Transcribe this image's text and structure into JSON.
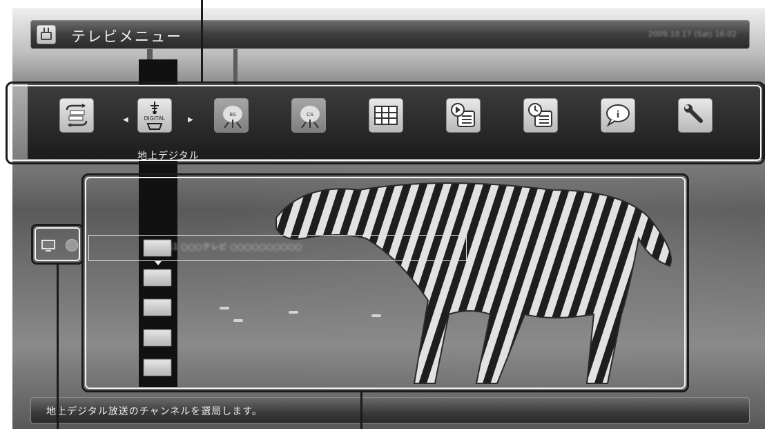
{
  "header": {
    "title": "テレビメニュー",
    "datetime": "2009.10.17 (Sat) 16:02",
    "icon": "tv-icon"
  },
  "menu": {
    "selected_label": "地上デジタル",
    "items": [
      {
        "name": "broadcast-switch",
        "icon": "broadcast-switch-icon"
      },
      {
        "name": "digital-terrestrial",
        "icon": "digital-terrestrial-icon",
        "tile_text": "DIGITAL"
      },
      {
        "name": "bs",
        "icon": "bs-satellite-icon",
        "tile_text": "BS"
      },
      {
        "name": "cs",
        "icon": "cs-satellite-icon",
        "tile_text": "CS"
      },
      {
        "name": "program-guide",
        "icon": "grid-guide-icon"
      },
      {
        "name": "recorded-playback",
        "icon": "play-list-icon"
      },
      {
        "name": "reservation-list",
        "icon": "clock-list-icon"
      },
      {
        "name": "information",
        "icon": "info-bubble-icon",
        "tile_text": "i"
      },
      {
        "name": "settings",
        "icon": "wrench-icon"
      }
    ]
  },
  "channel_list": {
    "selected_row_text": "011 ○○○テレビ ○○○○○○○○○○"
  },
  "footer": {
    "message": "地上デジタル放送のチャンネルを選局します。"
  },
  "colors": {
    "outline": "#1a1a1a",
    "bar_dark": "#1c1c1c",
    "text_light": "#f0f0f0"
  }
}
